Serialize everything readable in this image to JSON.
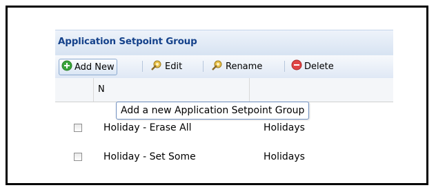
{
  "panel": {
    "title": "Application Setpoint Group"
  },
  "toolbar": {
    "add_new": "Add New",
    "edit": "Edit",
    "rename": "Rename",
    "delete": "Delete"
  },
  "header": {
    "name_col_label": "N"
  },
  "rows": [
    {
      "name": "Holiday - Erase All",
      "group": "Holidays"
    },
    {
      "name": "Holiday - Set Some",
      "group": "Holidays"
    }
  ],
  "tooltip": "Add a new Application Setpoint Group",
  "colors": {
    "title": "#15428b",
    "border": "#99bbe8",
    "add_icon": "#3aa43a",
    "delete_icon": "#e04545"
  },
  "icons": {
    "add": "plus-circle-icon",
    "edit": "gear-pencil-icon",
    "rename": "gear-pencil-icon",
    "delete": "minus-circle-icon"
  }
}
